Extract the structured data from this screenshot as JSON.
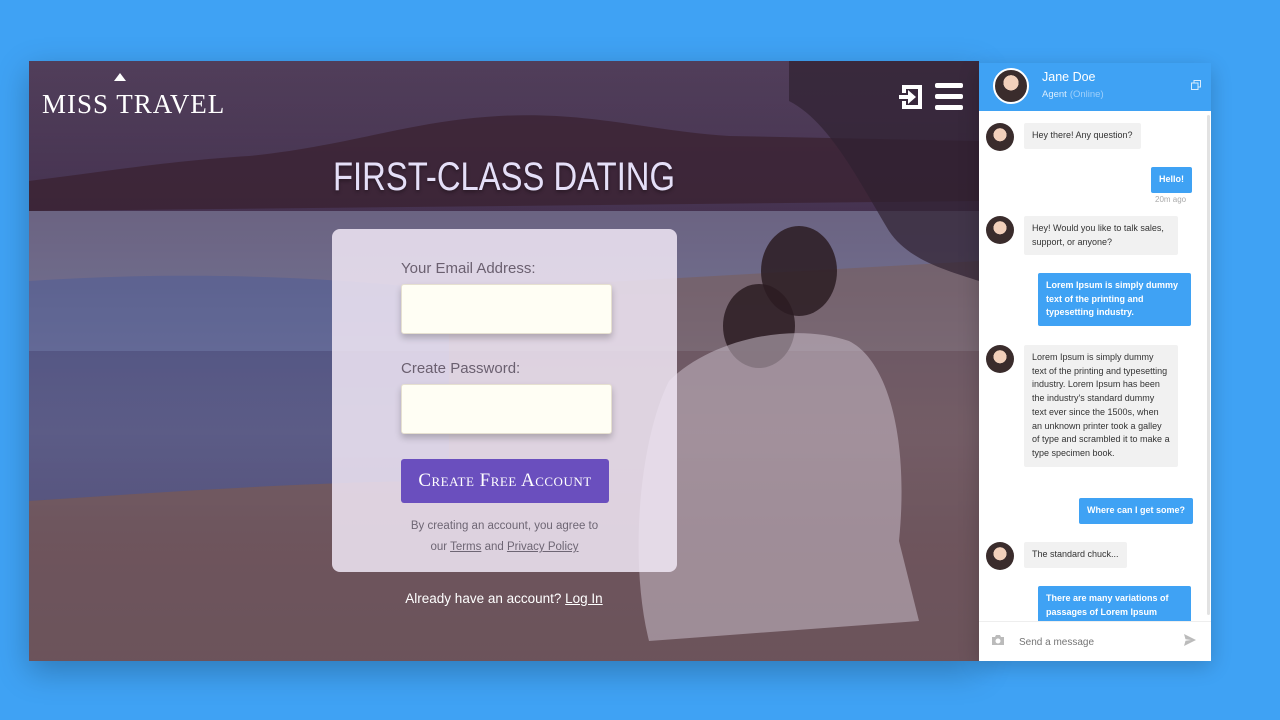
{
  "brand": {
    "name": "MISS TRAVEL"
  },
  "header": {
    "login_icon": "login-icon",
    "menu_icon": "menu-icon"
  },
  "hero": {
    "headline": "FIRST-CLASS DATING"
  },
  "signup": {
    "email_label": "Your Email Address:",
    "email_value": "",
    "password_label": "Create Password:",
    "password_value": "",
    "cta_label": "Create Free Account",
    "terms_prefix": "By creating an account, you agree to",
    "terms_our": "our",
    "terms_link": "Terms",
    "terms_and": "and",
    "privacy_link": "Privacy Policy"
  },
  "login_prompt": {
    "text": "Already have an account?",
    "link": "Log In"
  },
  "chat": {
    "agent_name": "Jane Doe",
    "agent_role": "Agent",
    "agent_status": "(Online)",
    "messages": [
      {
        "from": "agent",
        "text": "Hey there! Any question?"
      },
      {
        "from": "user",
        "text": "Hello!"
      },
      {
        "from": "meta",
        "text": "20m ago"
      },
      {
        "from": "agent",
        "text": "Hey! Would you like to talk sales, support, or anyone?"
      },
      {
        "from": "user",
        "text": "Lorem Ipsum is simply dummy text of the printing and typesetting industry."
      },
      {
        "from": "agent",
        "text": "Lorem Ipsum is simply dummy text of the printing and typesetting industry. Lorem Ipsum has been the industry's standard dummy text ever since the 1500s, when an unknown printer took a galley of type and scrambled it to make a type specimen book."
      },
      {
        "from": "user",
        "text": "Where can I get some?"
      },
      {
        "from": "agent",
        "text": "The standard chuck..."
      },
      {
        "from": "user",
        "text": "There are many variations of passages of Lorem Ipsum"
      }
    ],
    "input_placeholder": "Send a message",
    "input_value": ""
  },
  "colors": {
    "page_bg": "#3fa2f4",
    "cta": "#6a4fbe",
    "chat_accent": "#3fa2f4"
  }
}
